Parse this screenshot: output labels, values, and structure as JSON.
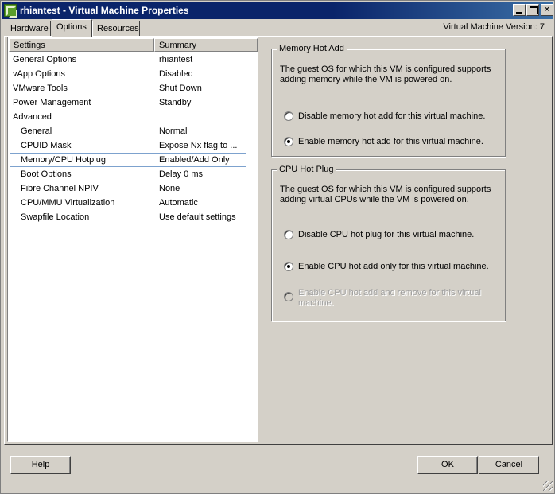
{
  "window": {
    "title": "rhiantest - Virtual Machine Properties",
    "version": "Virtual Machine Version: 7"
  },
  "tabs": [
    "Hardware",
    "Options",
    "Resources"
  ],
  "settings_list": {
    "headers": [
      "Settings",
      "Summary"
    ],
    "rows": [
      {
        "setting": "General Options",
        "summary": "rhiantest"
      },
      {
        "setting": "vApp Options",
        "summary": "Disabled"
      },
      {
        "setting": "VMware Tools",
        "summary": "Shut Down"
      },
      {
        "setting": "Power Management",
        "summary": "Standby"
      },
      {
        "setting": "Advanced",
        "summary": ""
      },
      {
        "setting": "General",
        "summary": "Normal"
      },
      {
        "setting": "CPUID Mask",
        "summary": "Expose Nx flag to ..."
      },
      {
        "setting": "Memory/CPU Hotplug",
        "summary": "Enabled/Add Only"
      },
      {
        "setting": "Boot Options",
        "summary": "Delay 0 ms"
      },
      {
        "setting": "Fibre Channel NPIV",
        "summary": "None"
      },
      {
        "setting": "CPU/MMU Virtualization",
        "summary": "Automatic"
      },
      {
        "setting": "Swapfile Location",
        "summary": "Use default settings"
      }
    ]
  },
  "memory_hot_add": {
    "legend": "Memory Hot Add",
    "description": "The guest OS for which this VM is configured supports adding memory while the VM is powered on.",
    "options": [
      {
        "label": "Disable memory hot add for this virtual machine.",
        "checked": false
      },
      {
        "label": "Enable memory hot add for this virtual machine.",
        "checked": true
      }
    ]
  },
  "cpu_hot_plug": {
    "legend": "CPU Hot Plug",
    "description": "The guest OS for which this VM is configured supports adding virtual CPUs while the VM is powered on.",
    "options": [
      {
        "label": "Disable CPU hot plug for this virtual machine.",
        "checked": false
      },
      {
        "label": "Enable CPU hot add only for this virtual machine.",
        "checked": true
      },
      {
        "label": "Enable CPU hot add and remove for this virtual machine.",
        "checked": false,
        "disabled": true
      }
    ]
  },
  "buttons": {
    "help": "Help",
    "ok": "OK",
    "cancel": "Cancel"
  }
}
